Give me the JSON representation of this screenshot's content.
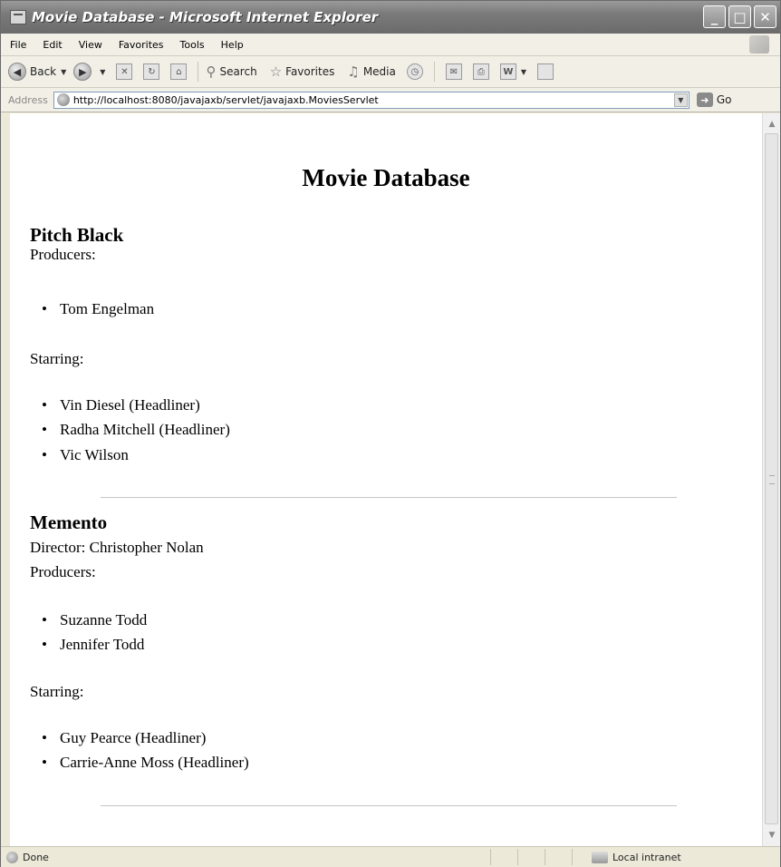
{
  "window": {
    "title": "Movie Database - Microsoft Internet Explorer",
    "buttons": {
      "minimize": "_",
      "maximize": "□",
      "close": "✕"
    }
  },
  "menubar": {
    "items": [
      "File",
      "Edit",
      "View",
      "Favorites",
      "Tools",
      "Help"
    ]
  },
  "toolbar": {
    "back_label": "Back",
    "search_label": "Search",
    "favorites_label": "Favorites",
    "media_label": "Media"
  },
  "address": {
    "label": "Address",
    "url": "http://localhost:8080/javajaxb/servlet/javajaxb.MoviesServlet",
    "go_label": "Go"
  },
  "page": {
    "heading": "Movie Database",
    "movies": [
      {
        "title": "Pitch Black",
        "producers_label": "Producers:",
        "producers": [
          "Tom Engelman"
        ],
        "starring_label": "Starring:",
        "starring": [
          "Vin Diesel (Headliner)",
          "Radha Mitchell (Headliner)",
          "Vic Wilson"
        ]
      },
      {
        "title": "Memento",
        "director": "Director: Christopher Nolan",
        "producers_label": "Producers:",
        "producers": [
          "Suzanne Todd",
          "Jennifer Todd"
        ],
        "starring_label": "Starring:",
        "starring": [
          "Guy Pearce (Headliner)",
          "Carrie-Anne Moss (Headliner)"
        ]
      }
    ]
  },
  "status": {
    "text": "Done",
    "zone": "Local intranet"
  },
  "icons": [
    "ie-page-icon",
    "back-arrow-icon",
    "forward-arrow-icon",
    "stop-icon",
    "refresh-icon",
    "home-icon",
    "search-icon",
    "favorites-star-icon",
    "media-icon",
    "history-icon",
    "mail-icon",
    "print-icon",
    "word-icon",
    "go-arrow-icon",
    "local-intranet-icon"
  ]
}
